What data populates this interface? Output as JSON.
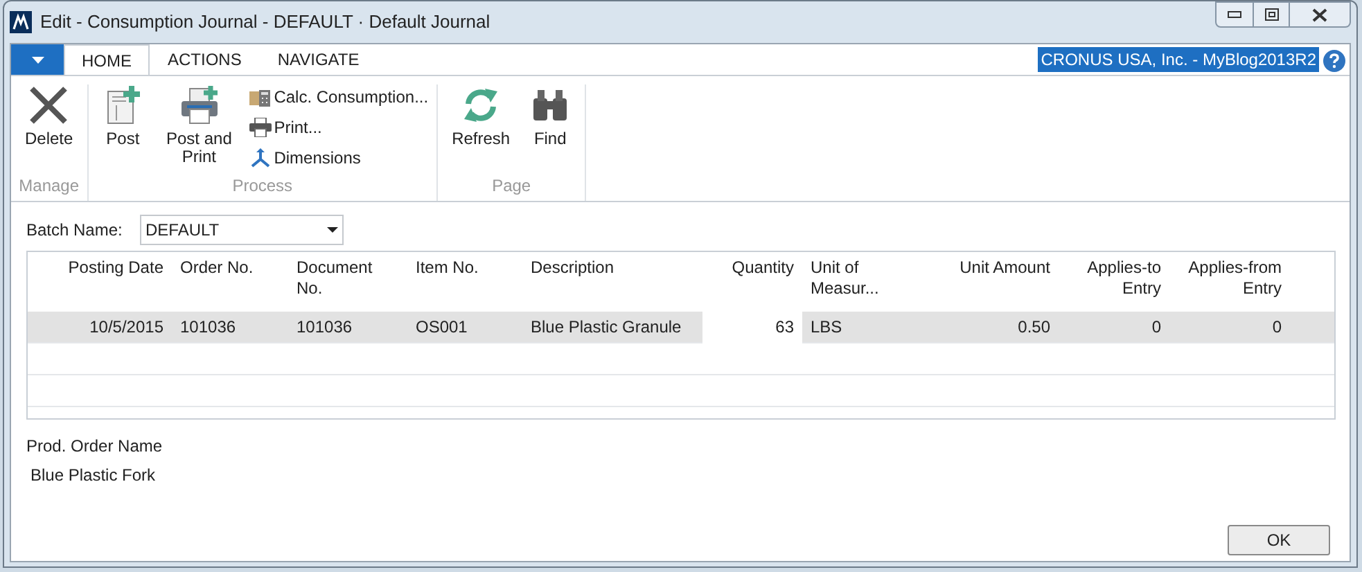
{
  "window": {
    "title": "Edit - Consumption Journal - DEFAULT · Default Journal"
  },
  "tabs": [
    {
      "label": "HOME",
      "selected": true
    },
    {
      "label": "ACTIONS",
      "selected": false
    },
    {
      "label": "NAVIGATE",
      "selected": false
    }
  ],
  "company": "CRONUS USA, Inc. - MyBlog2013R2",
  "ribbon": [
    {
      "label": "Manage",
      "buttons": [
        {
          "kind": "large",
          "label": "Delete"
        }
      ]
    },
    {
      "label": "Process",
      "buttons": [
        {
          "kind": "large",
          "label": "Post"
        },
        {
          "kind": "large",
          "label": "Post and Print"
        },
        {
          "kind": "small",
          "label": "Calc. Consumption..."
        },
        {
          "kind": "small",
          "label": "Print..."
        },
        {
          "kind": "small",
          "label": "Dimensions"
        }
      ]
    },
    {
      "label": "Page",
      "buttons": [
        {
          "kind": "large",
          "label": "Refresh"
        },
        {
          "kind": "large",
          "label": "Find"
        }
      ]
    }
  ],
  "batch": {
    "label": "Batch Name:",
    "value": "DEFAULT"
  },
  "table": {
    "columns": [
      {
        "label": "Posting Date",
        "kind": "number"
      },
      {
        "label": "Order No.",
        "kind": "text"
      },
      {
        "label": "Document No.",
        "kind": "text"
      },
      {
        "label": "Item No.",
        "kind": "text"
      },
      {
        "label": "Description",
        "kind": "text"
      },
      {
        "label": "Quantity",
        "kind": "number"
      },
      {
        "label": "Unit of Measur...",
        "kind": "text"
      },
      {
        "label": "Unit Amount",
        "kind": "number"
      },
      {
        "label": "Applies-to Entry",
        "kind": "number"
      },
      {
        "label": "Applies-from Entry",
        "kind": "number"
      }
    ],
    "rows": [
      {
        "selected": true,
        "cells": [
          "10/5/2015",
          "101036",
          "101036",
          "OS001",
          "Blue Plastic Granule",
          "63",
          "LBS",
          "0.50",
          "0",
          "0"
        ]
      }
    ]
  },
  "footer": {
    "label": "Prod. Order Name",
    "value": "Blue Plastic Fork"
  },
  "buttons": [
    "OK"
  ]
}
